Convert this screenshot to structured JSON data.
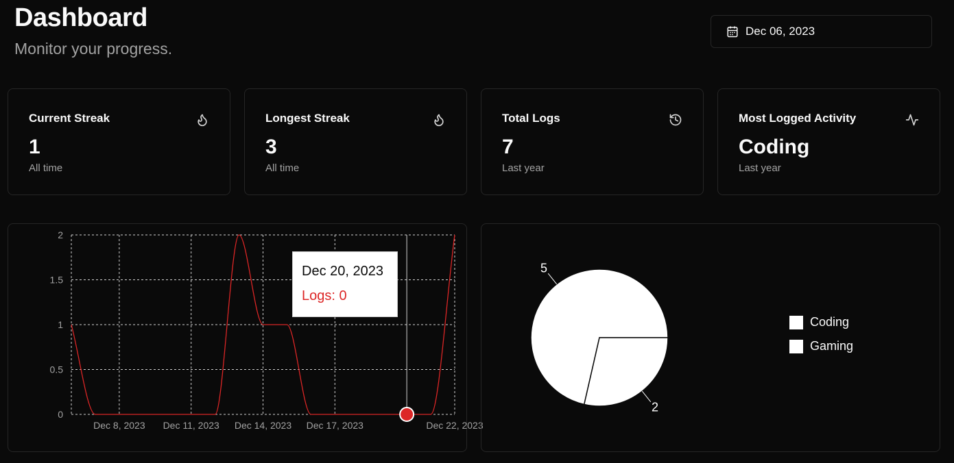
{
  "header": {
    "title": "Dashboard",
    "subtitle": "Monitor your progress.",
    "date": "Dec 06, 2023"
  },
  "cards": [
    {
      "label": "Current Streak",
      "value": "1",
      "sub": "All time",
      "icon": "flame-icon"
    },
    {
      "label": "Longest Streak",
      "value": "3",
      "sub": "All time",
      "icon": "flame-icon"
    },
    {
      "label": "Total Logs",
      "value": "7",
      "sub": "Last year",
      "icon": "history-icon"
    },
    {
      "label": "Most Logged Activity",
      "value": "Coding",
      "sub": "Last year",
      "icon": "activity-icon"
    }
  ],
  "tooltip": {
    "date": "Dec 20, 2023",
    "logs": "Logs: 0"
  },
  "colors": {
    "background": "#0a0a0a",
    "line": "#dc2626",
    "muted": "#a3a3a3"
  },
  "chart_data": [
    {
      "type": "line",
      "x": [
        "Dec 6, 2023",
        "Dec 7, 2023",
        "Dec 8, 2023",
        "Dec 9, 2023",
        "Dec 10, 2023",
        "Dec 11, 2023",
        "Dec 12, 2023",
        "Dec 13, 2023",
        "Dec 14, 2023",
        "Dec 15, 2023",
        "Dec 16, 2023",
        "Dec 17, 2023",
        "Dec 18, 2023",
        "Dec 19, 2023",
        "Dec 20, 2023",
        "Dec 21, 2023",
        "Dec 22, 2023"
      ],
      "series": [
        {
          "values": [
            1,
            0,
            0,
            0,
            0,
            0,
            0,
            2,
            1,
            1,
            0,
            0,
            0,
            0,
            0,
            0,
            2
          ]
        }
      ],
      "xticks": [
        "Dec 8, 2023",
        "Dec 11, 2023",
        "Dec 14, 2023",
        "Dec 17, 2023",
        "Dec 22, 2023"
      ],
      "yticks": [
        "0",
        "0.5",
        "1",
        "1.5",
        "2"
      ],
      "ylim": [
        0,
        2
      ],
      "grid": true,
      "active_point": "Dec 20, 2023"
    },
    {
      "type": "pie",
      "labels": [
        "Coding",
        "Gaming"
      ],
      "values": [
        5,
        2
      ],
      "legend": "right"
    }
  ]
}
